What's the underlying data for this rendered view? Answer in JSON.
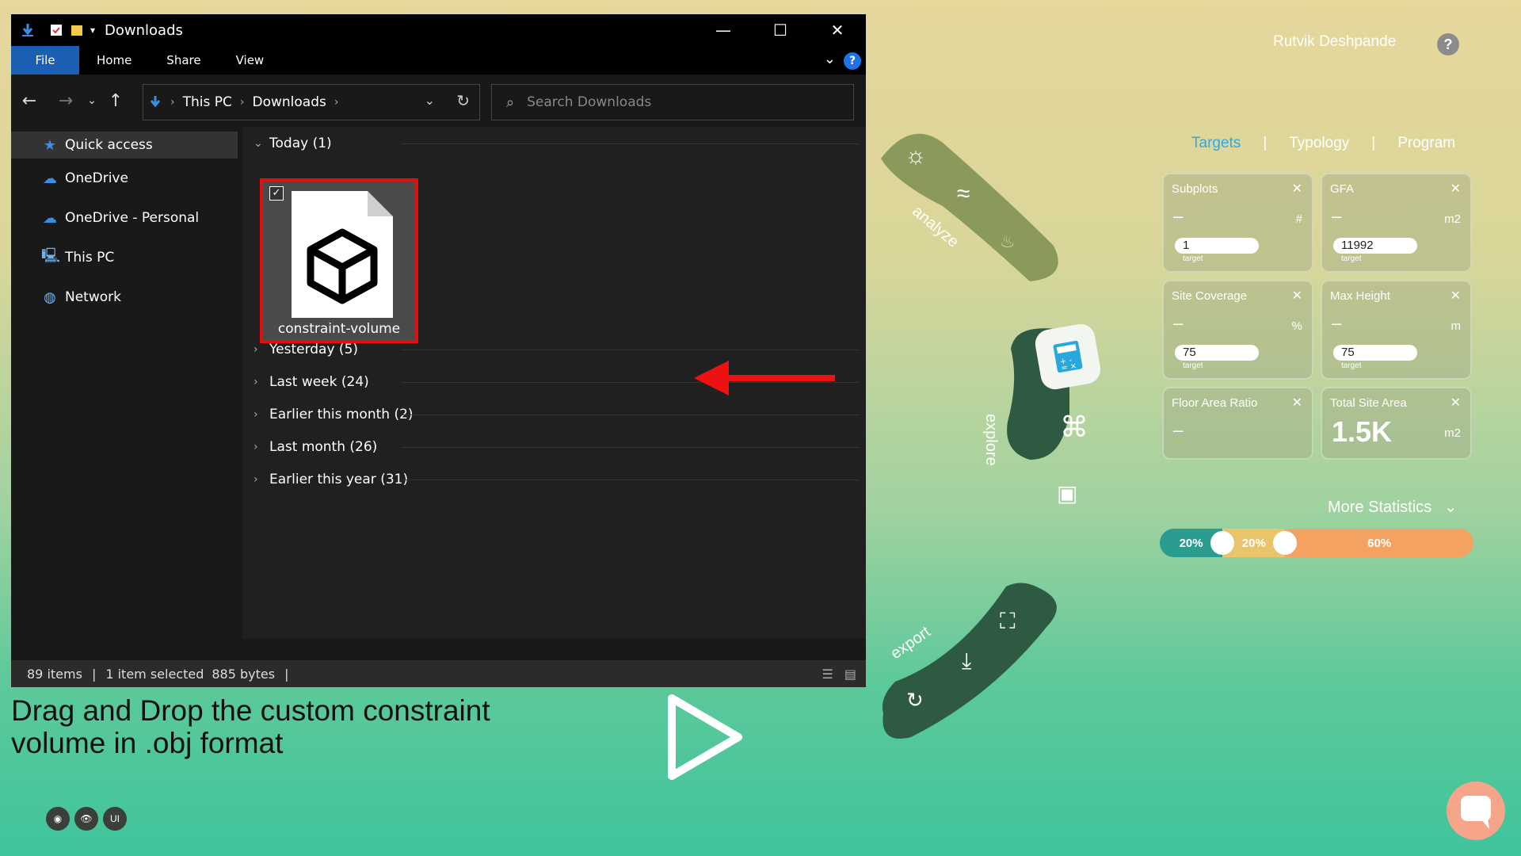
{
  "explorer": {
    "title": "Downloads",
    "ribbon_tabs": [
      "File",
      "Home",
      "Share",
      "View"
    ],
    "help": "?",
    "breadcrumb": [
      "This PC",
      "Downloads"
    ],
    "search_placeholder": "Search Downloads",
    "sidebar": [
      "Quick access",
      "OneDrive",
      "OneDrive - Personal",
      "This PC",
      "Network"
    ],
    "groups": {
      "today": "Today (1)",
      "others": [
        "Yesterday (5)",
        "Last week (24)",
        "Earlier this month (2)",
        "Last month (26)",
        "Earlier this year (31)"
      ]
    },
    "file": {
      "name": "constraint-volume",
      "checked": true
    },
    "status": {
      "count": "89 items",
      "selected": "1 item selected",
      "size": "885 bytes"
    }
  },
  "app": {
    "user": "Rutvik Deshpande",
    "help": "?",
    "wheel": {
      "analyze": "analyze",
      "explore": "explore",
      "export": "export"
    },
    "tabs": [
      "Targets",
      "Typology",
      "Program"
    ],
    "cards": [
      {
        "label": "Subplots",
        "value": "–",
        "unit": "#",
        "target": "1",
        "target_label": "target"
      },
      {
        "label": "GFA",
        "value": "–",
        "unit": "m2",
        "target": "11992",
        "target_label": "target"
      },
      {
        "label": "Site Coverage",
        "value": "–",
        "unit": "%",
        "target": "75",
        "target_label": "target"
      },
      {
        "label": "Max Height",
        "value": "–",
        "unit": "m",
        "target": "75",
        "target_label": "target"
      },
      {
        "label": "Floor Area Ratio",
        "value": "–"
      },
      {
        "label": "Total Site Area",
        "value": "1.5K",
        "unit": "m2"
      }
    ],
    "close_glyph": "✕",
    "more_statistics": "More Statistics",
    "split": [
      {
        "label": "20%",
        "value": 20,
        "color": "#2a9d8f"
      },
      {
        "label": "20%",
        "value": 20,
        "color": "#e9c46a"
      },
      {
        "label": "60%",
        "value": 60,
        "color": "#f4a261"
      }
    ],
    "caption": "Drag and Drop the custom constraint volume in .obj format",
    "bottom_buttons": [
      "camera-icon",
      "eye-icon",
      "UI"
    ]
  }
}
